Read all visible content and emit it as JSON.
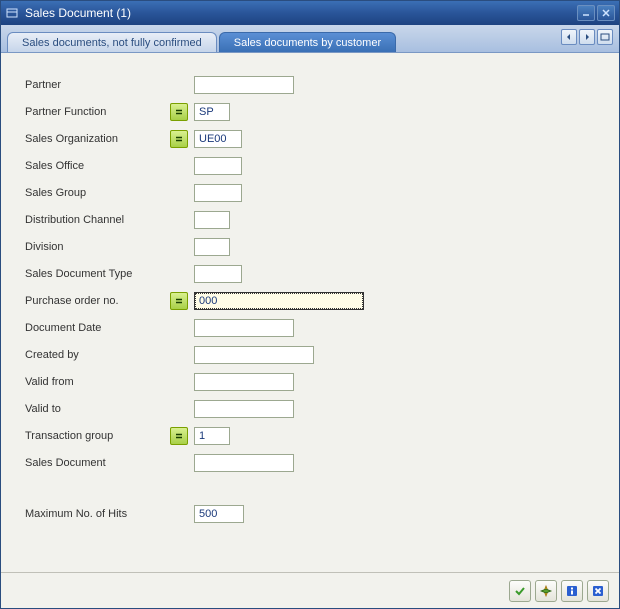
{
  "window": {
    "title": "Sales Document (1)"
  },
  "tabs": {
    "inactive": "Sales documents, not fully confirmed",
    "active": "Sales documents by customer"
  },
  "form": {
    "partner": {
      "label": "Partner",
      "value": ""
    },
    "partner_function": {
      "label": "Partner Function",
      "value": "SP"
    },
    "sales_org": {
      "label": "Sales Organization",
      "value": "UE00"
    },
    "sales_office": {
      "label": "Sales Office",
      "value": ""
    },
    "sales_group": {
      "label": "Sales Group",
      "value": ""
    },
    "dist_channel": {
      "label": "Distribution Channel",
      "value": ""
    },
    "division": {
      "label": "Division",
      "value": ""
    },
    "doc_type": {
      "label": "Sales Document Type",
      "value": ""
    },
    "po_no": {
      "label": "Purchase order no.",
      "value": "000"
    },
    "doc_date": {
      "label": "Document Date",
      "value": ""
    },
    "created_by": {
      "label": "Created by",
      "value": ""
    },
    "valid_from": {
      "label": "Valid from",
      "value": ""
    },
    "valid_to": {
      "label": "Valid to",
      "value": ""
    },
    "trans_group": {
      "label": "Transaction group",
      "value": "1"
    },
    "sales_doc": {
      "label": "Sales Document",
      "value": ""
    },
    "max_hits": {
      "label": "Maximum No. of Hits",
      "value": "500"
    }
  }
}
